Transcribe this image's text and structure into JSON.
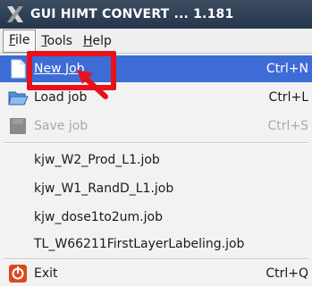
{
  "window": {
    "title": "GUI HIMT CONVERT ... 1.181",
    "icon": "x-logo-icon"
  },
  "menubar": [
    {
      "label": "File",
      "underline": "F",
      "active": true
    },
    {
      "label": "Tools",
      "underline": "T",
      "active": false
    },
    {
      "label": "Help",
      "underline": "H",
      "active": false
    }
  ],
  "file_menu": {
    "new_job": {
      "label": "New Job",
      "shortcut": "Ctrl+N",
      "icon": "new-document-icon",
      "highlighted": true
    },
    "load_job": {
      "label": "Load job",
      "shortcut": "Ctrl+L",
      "icon": "open-folder-icon"
    },
    "save_job": {
      "label": "Save job",
      "shortcut": "Ctrl+S",
      "icon": "save-icon",
      "disabled": true
    },
    "recent": [
      "kjw_W2_Prod_L1.job",
      "kjw_W1_RandD_L1.job",
      "kjw_dose1to2um.job",
      "TL_W66211FirstLayerLabeling.job"
    ],
    "exit": {
      "label": "Exit",
      "shortcut": "Ctrl+Q",
      "icon": "exit-icon"
    }
  },
  "annotation": {
    "color": "#e8111b",
    "shape": "box-with-arrow"
  },
  "colors": {
    "highlight": "#3d6cd6",
    "titlebar": "#2d3e55",
    "menu_bg": "#f2f2f2"
  }
}
